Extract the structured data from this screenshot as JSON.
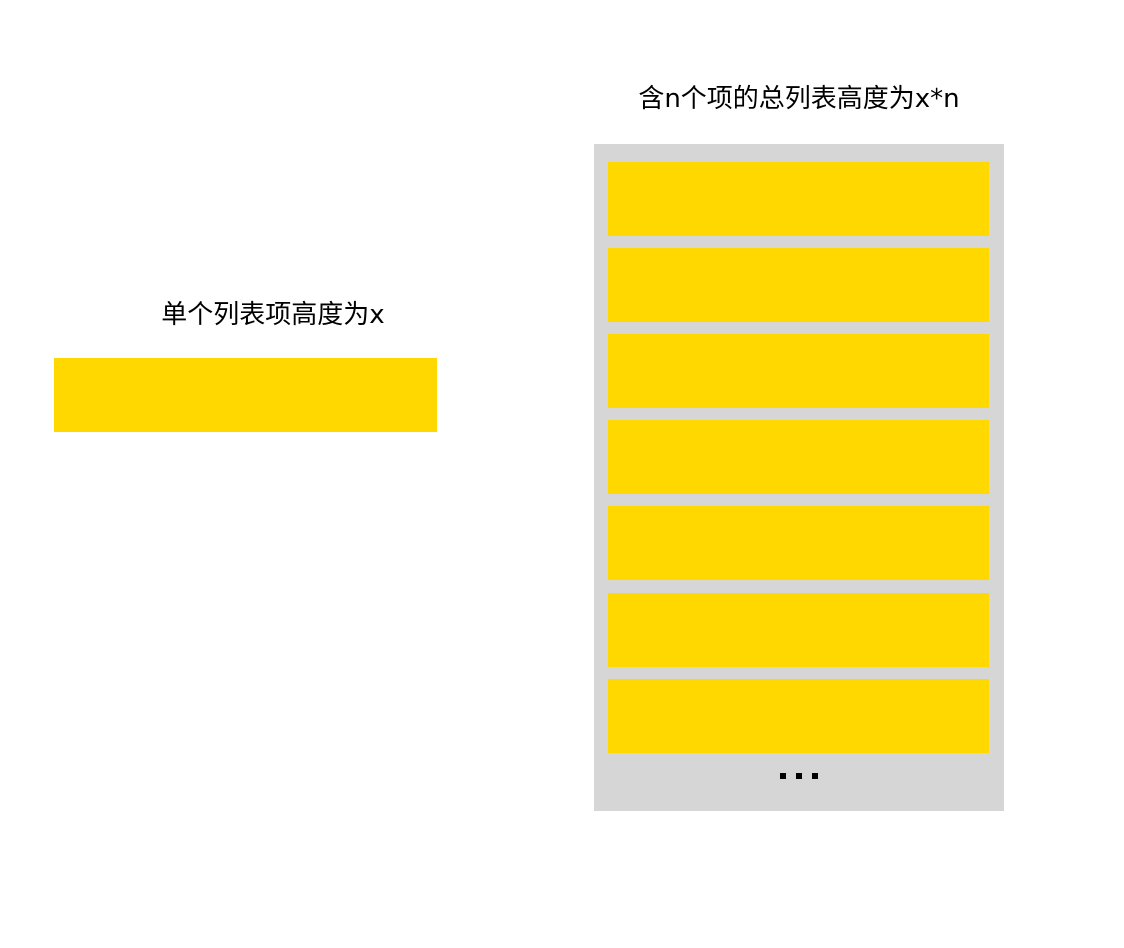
{
  "single": {
    "caption": "单个列表项高度为x"
  },
  "list": {
    "caption": "含n个项的总列表高度为x*n",
    "item_count": 7
  },
  "colors": {
    "item_fill": "#FFD800",
    "list_background": "#D6D6D6",
    "page_background": "#FFFFFF",
    "text": "#000000"
  }
}
